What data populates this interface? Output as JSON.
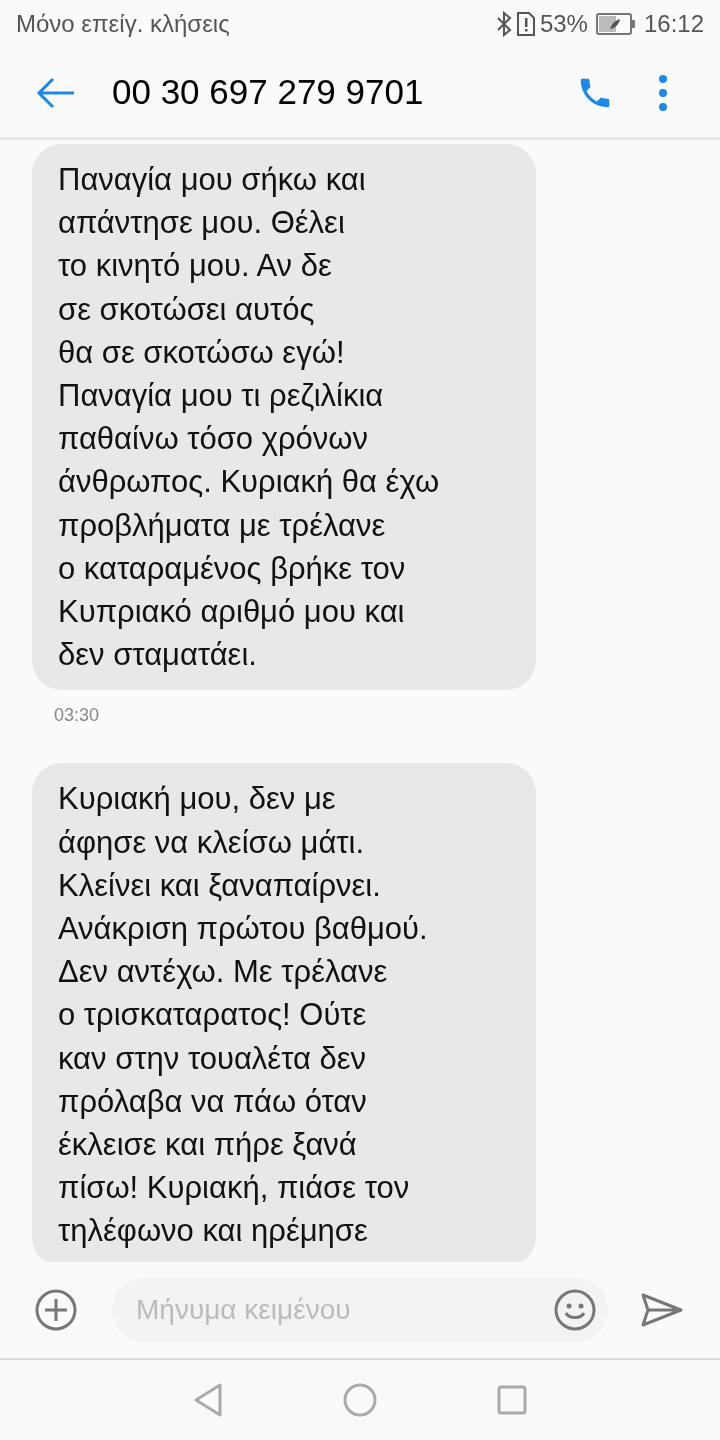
{
  "status_bar": {
    "carrier": "Μόνο επείγ. κλήσεις",
    "battery": "53%",
    "time": "16:12"
  },
  "header": {
    "title": "00 30 697 279 9701"
  },
  "messages": [
    {
      "text": "Παναγία μου σήκω και\nαπάντησε μου. Θέλει\nτο κινητό μου. Αν δε\nσε σκοτώσει αυτός\nθα σε σκοτώσω εγώ!\nΠαναγία μου τι ρεζιλίκια\nπαθαίνω τόσο χρόνων\nάνθρωπος. Κυριακή θα έχω\nπροβλήματα με τρέλανε\nο καταραμένος βρήκε τον\nΚυπριακό αριθμό μου και\nδεν σταματάει.",
      "time": "03:30"
    },
    {
      "text": "Κυριακή μου, δεν με\nάφησε να κλείσω μάτι.\nΚλείνει και ξαναπαίρνει.\nΑνάκριση πρώτου βαθμού.\nΔεν αντέχω. Με τρέλανε\nο τρισκαταρατος! Ούτε\nκαν στην τουαλέτα δεν\nπρόλαβα να πάω όταν\nέκλεισε και πήρε ξανά\nπίσω! Κυριακή, πιάσε τον\nτηλέφωνο και ηρέμησε"
    }
  ],
  "composer": {
    "placeholder": "Μήνυμα κειμένου"
  }
}
